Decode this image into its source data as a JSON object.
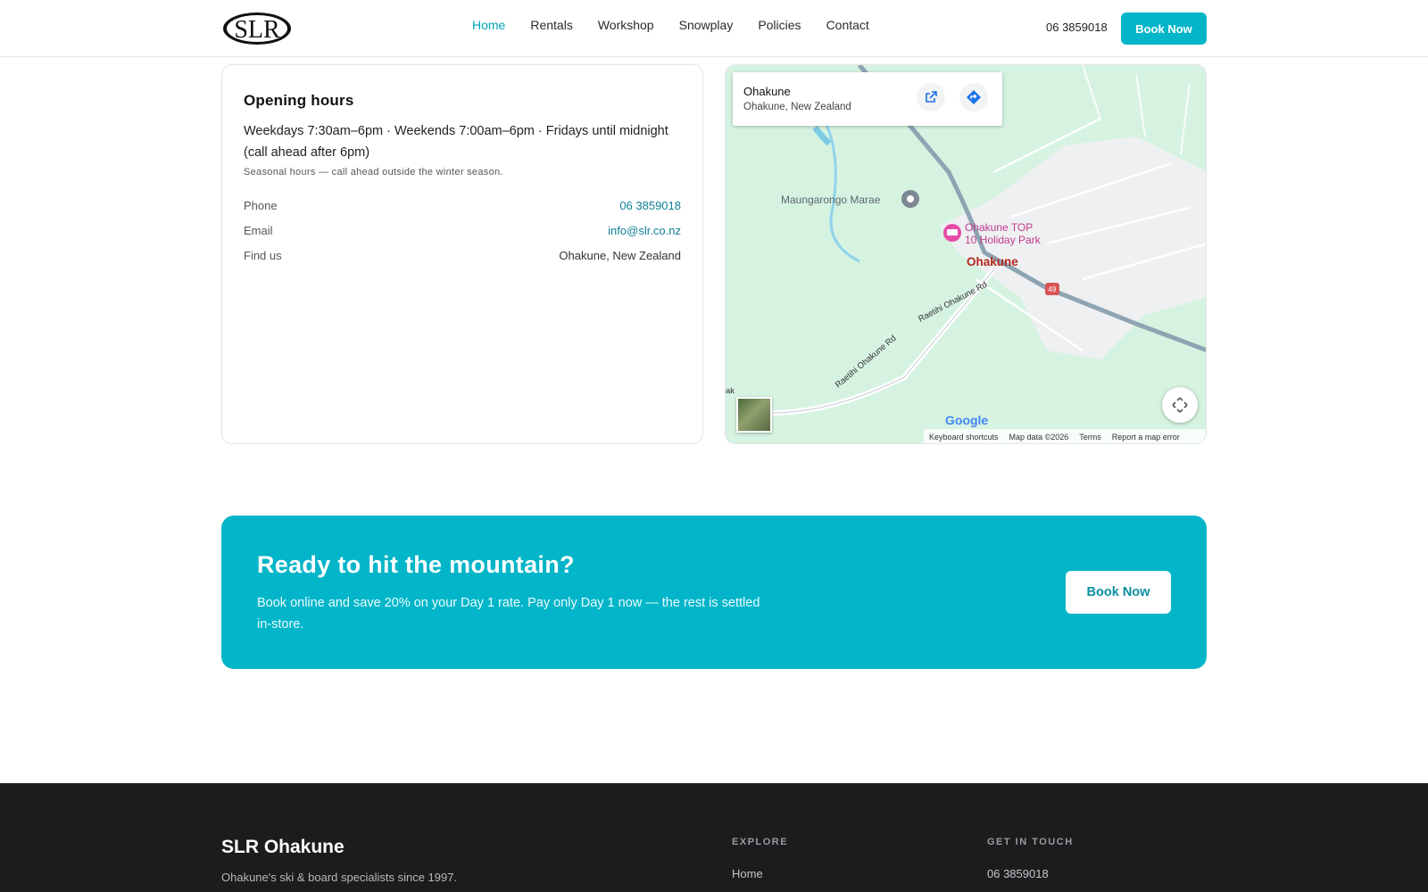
{
  "header": {
    "logo_text": "SLR",
    "nav": [
      {
        "label": "Home",
        "active": true
      },
      {
        "label": "Rentals",
        "active": false
      },
      {
        "label": "Workshop",
        "active": false
      },
      {
        "label": "Snowplay",
        "active": false
      },
      {
        "label": "Policies",
        "active": false
      },
      {
        "label": "Contact",
        "active": false
      }
    ],
    "phone": "06 3859018",
    "book_label": "Book Now"
  },
  "hours_card": {
    "title": "Opening hours",
    "hours_text": "Weekdays 7:30am–6pm · Weekends 7:00am–6pm · Fridays until midnight (call ahead after 6pm)",
    "seasonal_note": "Seasonal hours — call ahead outside the winter season.",
    "rows": [
      {
        "label": "Phone",
        "value": "06 3859018"
      },
      {
        "label": "Email",
        "value": "info@slr.co.nz"
      },
      {
        "label": "Find us",
        "value": "Ohakune, New Zealand"
      }
    ]
  },
  "map": {
    "place_name": "Ohakune",
    "place_address": "Ohakune, New Zealand",
    "labels": {
      "marae": "Maungarongo Marae",
      "holiday_park_1": "Ohakune TOP",
      "holiday_park_2": "10 Holiday Park",
      "town": "Ohakune",
      "road_1": "Raetihi Ohakune Rd",
      "road_2": "Raetihi Ohakune Rd",
      "highway": "49",
      "edge_fragment": "ak"
    },
    "google_logo": "Google",
    "footer_links": [
      "Keyboard shortcuts",
      "Map data ©2026",
      "Terms",
      "Report a map error"
    ]
  },
  "cta": {
    "title": "Ready to hit the mountain?",
    "text": "Book online and save 20% on your Day 1 rate. Pay only Day 1 now — the rest is settled in-store.",
    "button_label": "Book Now"
  },
  "footer": {
    "brand": "SLR Ohakune",
    "tagline": "Ohakune's ski & board specialists since 1997.",
    "explore_heading": "EXPLORE",
    "explore_first": "Home",
    "contact_heading": "GET IN TOUCH",
    "contact_first": "06 3859018"
  },
  "colors": {
    "accent": "#03b5c9",
    "link": "#0f7f95",
    "footer_bg": "#1c1c1e"
  }
}
